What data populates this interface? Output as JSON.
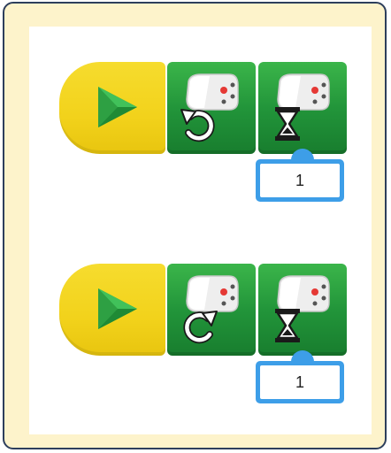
{
  "colors": {
    "frame_background": "#fdf3cb",
    "frame_border": "#2d3e5c",
    "start_block": "#f2d21b",
    "motor_block": "#22953a",
    "input_accent": "#3d9ee8",
    "play_triangle": "#2ea043"
  },
  "programs": [
    {
      "start_icon": "play-icon",
      "direction_icon": "rotate-counterclockwise-icon",
      "wait_icon": "hourglass-icon",
      "duration": "1"
    },
    {
      "start_icon": "play-icon",
      "direction_icon": "rotate-clockwise-icon",
      "wait_icon": "hourglass-icon",
      "duration": "1"
    }
  ]
}
